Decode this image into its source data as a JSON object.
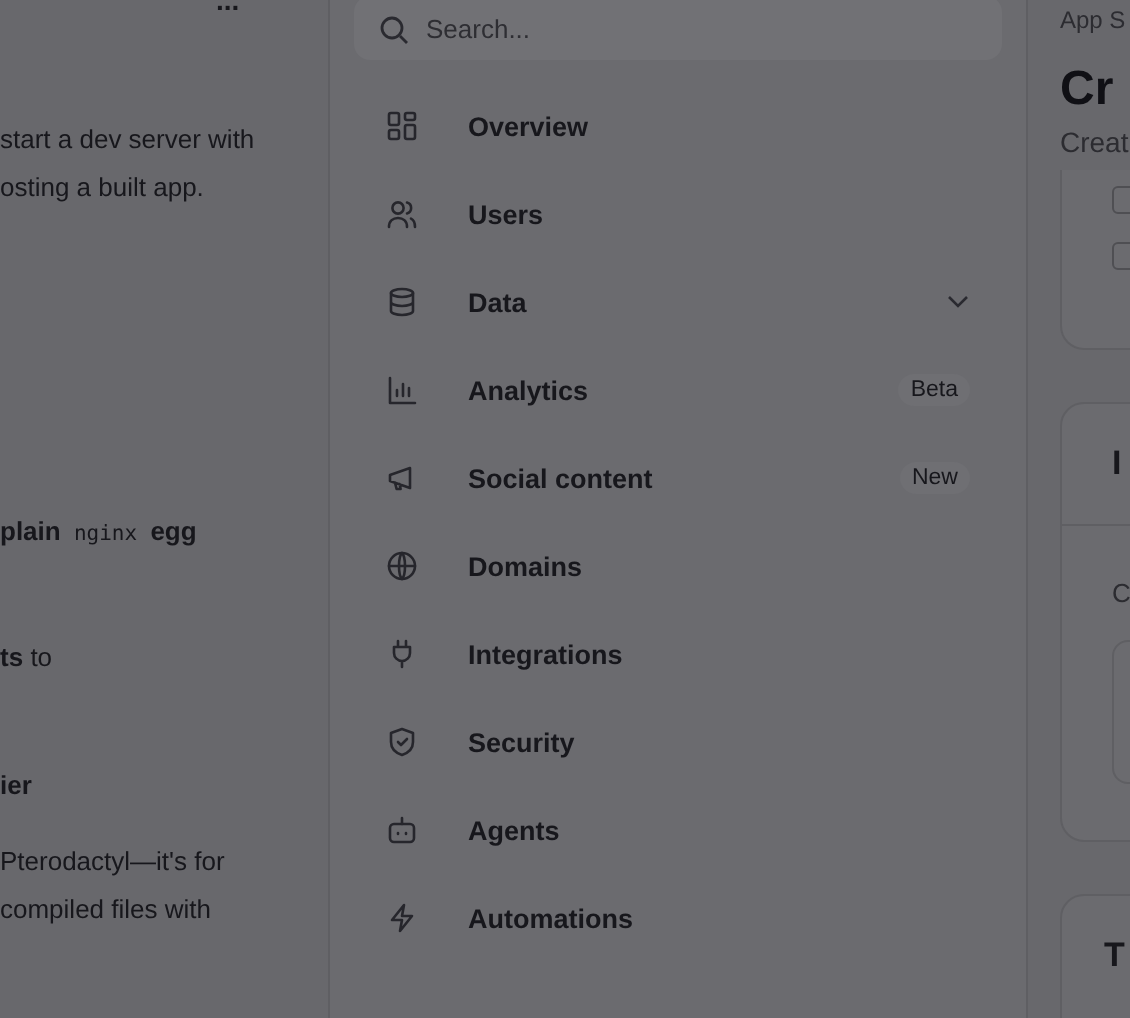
{
  "left_panel": {
    "more_menu": "...",
    "blocks": [
      {
        "kind": "text",
        "lines": [
          [
            {
              "kind": "plain",
              "text": "start a dev server with"
            }
          ],
          [
            {
              "kind": "plain",
              "text": "osting a built app."
            }
          ]
        ]
      },
      {
        "kind": "text",
        "lines": [
          [
            {
              "kind": "bold",
              "text": "plain"
            },
            {
              "kind": "code",
              "text": "nginx"
            },
            {
              "kind": "bold",
              "text": "egg"
            }
          ]
        ]
      },
      {
        "kind": "text",
        "lines": [
          [
            {
              "kind": "bold",
              "text": "ts"
            },
            {
              "kind": "plain",
              "text": "to"
            }
          ]
        ]
      },
      {
        "kind": "heading",
        "lines": [
          [
            {
              "kind": "plain",
              "text": "ier"
            }
          ]
        ]
      },
      {
        "kind": "text",
        "lines": [
          [
            {
              "kind": "plain",
              "text": "Pterodactyl—it's for"
            }
          ],
          [
            {
              "kind": "plain",
              "text": "compiled files with"
            }
          ]
        ]
      }
    ]
  },
  "sidebar": {
    "search": {
      "placeholder": "Search..."
    },
    "items": [
      {
        "label": "Overview",
        "expandable": false
      },
      {
        "label": "Users",
        "expandable": false
      },
      {
        "label": "Data",
        "expandable": true
      },
      {
        "label": "Analytics",
        "badge": "Beta",
        "expandable": false
      },
      {
        "label": "Social content",
        "badge": "New",
        "expandable": false
      },
      {
        "label": "Domains",
        "expandable": false
      },
      {
        "label": "Integrations",
        "expandable": false
      },
      {
        "label": "Security",
        "expandable": false
      },
      {
        "label": "Agents",
        "expandable": false
      },
      {
        "label": "Automations",
        "expandable": false
      }
    ]
  },
  "right_panel": {
    "breadcrumb": "App S",
    "title": "Cr",
    "subtitle": "Creat",
    "checkboxes": [
      {
        "checked": false
      },
      {
        "checked": false
      }
    ],
    "card_title": "I",
    "card_text": "C",
    "next_card_title": "T"
  }
}
